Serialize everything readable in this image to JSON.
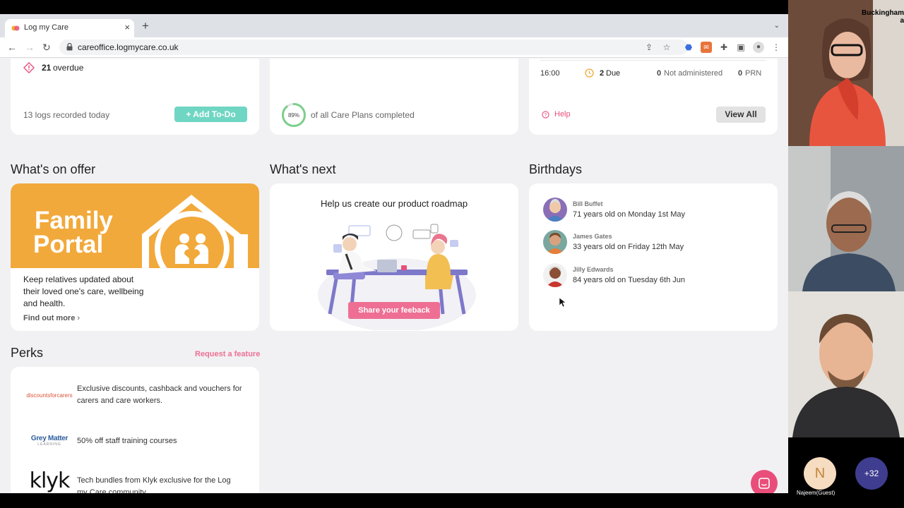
{
  "browser": {
    "tab_title": "Log my Care",
    "url": "careoffice.logmycare.co.uk",
    "new_tab_symbol": "+",
    "close_tab_symbol": "×"
  },
  "top_cards": {
    "overdue_count": "21",
    "overdue_label": "overdue",
    "logs_recorded": "13 logs recorded today",
    "add_todo_label": "Add To-Do",
    "care_plan_percent_text": "89%",
    "care_plan_percent": 0.89,
    "care_plan_label": "of all Care Plans completed",
    "med_time": "16:00",
    "due_count": "2",
    "due_label": "Due",
    "not_administered_count": "0",
    "not_administered_label": "Not administered",
    "prn_count": "0",
    "prn_label": "PRN",
    "help_label": "Help",
    "view_all_label": "View All"
  },
  "offer": {
    "title": "What's on offer",
    "promo_line1": "Family",
    "promo_line2": "Portal",
    "description": "Keep relatives updated about their loved one's care, wellbeing and health.",
    "link": "Find out more"
  },
  "next": {
    "title": "What's next",
    "heading": "Help us create our product roadmap",
    "button": "Share your feeback"
  },
  "birthdays": {
    "title": "Birthdays",
    "items": [
      {
        "name": "Bill Buffet",
        "text": "71 years old on Monday 1st May"
      },
      {
        "name": "James Gates",
        "text": "33 years old on Friday 12th May"
      },
      {
        "name": "Jilly Edwards",
        "text": "84 years old on Tuesday 6th Jun"
      }
    ]
  },
  "perks": {
    "title": "Perks",
    "request_link": "Request a feature",
    "items": [
      {
        "logo": "discountsforcarers",
        "text": "Exclusive discounts, cashback and vouchers for carers and care workers."
      },
      {
        "logo": "Grey Matter",
        "logo_sub": "LEARNING",
        "text": "50% off staff training courses"
      },
      {
        "logo": "klyk",
        "text": "Tech bundles from Klyk exclusive for the Log my Care community"
      }
    ]
  },
  "call": {
    "top_participant": "Buckingham",
    "top_participant_tail": "a",
    "guest_initial": "N",
    "guest_label": "Najeem(Guest)",
    "extra_count": "+32"
  },
  "colors": {
    "accent_teal": "#6fd6c3",
    "accent_pink": "#e94e7a",
    "promo_orange": "#f2a93b",
    "progress_green": "#7ccf8c"
  }
}
